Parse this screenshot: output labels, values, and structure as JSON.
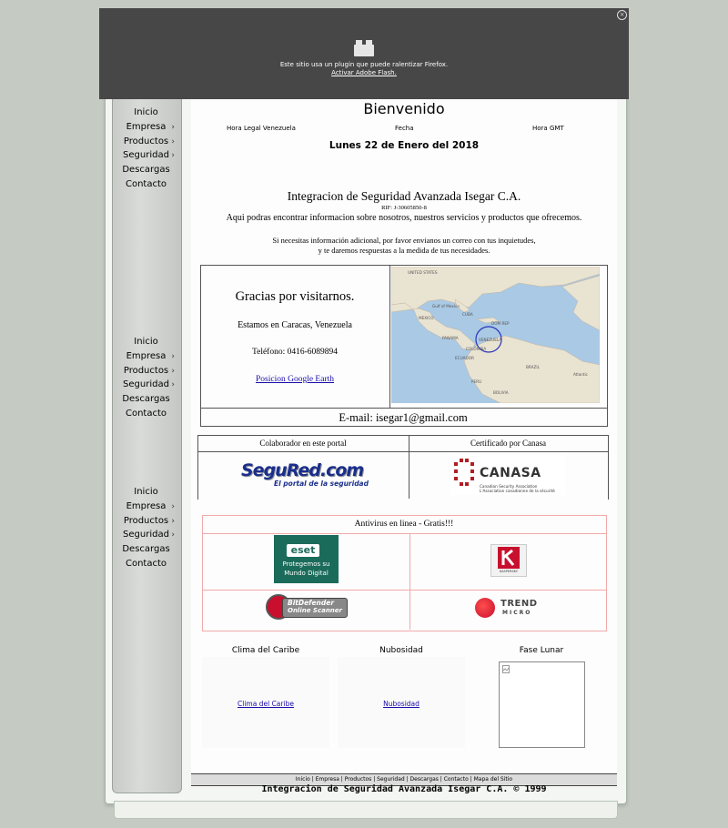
{
  "flash_bar": {
    "message": "Este sitio usa un plugin que puede ralentizar Firefox.",
    "link": "Activar Adobe Flash."
  },
  "menus": [
    {
      "items": [
        {
          "label": "Inicio",
          "arrow": ""
        },
        {
          "label": "Empresa",
          "arrow": "›"
        },
        {
          "label": "Productos",
          "arrow": "›"
        },
        {
          "label": "Seguridad",
          "arrow": "›"
        },
        {
          "label": "Descargas",
          "arrow": ""
        },
        {
          "label": "Contacto",
          "arrow": ""
        }
      ]
    },
    {
      "items": [
        {
          "label": "Inicio",
          "arrow": ""
        },
        {
          "label": "Empresa",
          "arrow": "›"
        },
        {
          "label": "Productos",
          "arrow": "›"
        },
        {
          "label": "Seguridad",
          "arrow": "›"
        },
        {
          "label": "Descargas",
          "arrow": ""
        },
        {
          "label": "Contacto",
          "arrow": ""
        }
      ]
    },
    {
      "items": [
        {
          "label": "Inicio",
          "arrow": ""
        },
        {
          "label": "Empresa",
          "arrow": "›"
        },
        {
          "label": "Productos",
          "arrow": "›"
        },
        {
          "label": "Seguridad",
          "arrow": "›"
        },
        {
          "label": "Descargas",
          "arrow": ""
        },
        {
          "label": "Contacto",
          "arrow": ""
        }
      ]
    }
  ],
  "header": {
    "title": "Bienvenido",
    "col_hora_legal": "Hora Legal Venezuela",
    "col_fecha": "Fecha",
    "col_hora_gmt": "Hora GMT",
    "date": "Lunes 22 de Enero del 2018"
  },
  "intro": {
    "company": "Integracion de Seguridad Avanzada Isegar C.A.",
    "rif": "RIF: J-30605850-8",
    "tagline": "Aqui podras encontrar informacion sobre nosotros, nuestros servicios y productos que ofrecemos.",
    "info1": "Si necesitas información adicional, por favor envianos un correo con tus inquietudes,",
    "info2": "y te daremos respuestas a la medida de tus necesidades."
  },
  "contact": {
    "thanks": "Gracias por visitarnos.",
    "location": "Estamos en Caracas, Venezuela",
    "phone": "Teléfono: 0416-6089894",
    "earth_link": "Posicion Google Earth",
    "email": "E-mail: isegar1@gmail.com",
    "map_labels": [
      "UNITED STATES",
      "Gulf of Mexico",
      "MEXICO",
      "CUBA",
      "DOM REP",
      "VENEZUELA",
      "COLOMBIA",
      "PANAMA",
      "BRAZIL",
      "ECUADOR",
      "PERU",
      "BOLIVIA",
      "Atlantic"
    ]
  },
  "partners": {
    "left_header": "Colaborador en este portal",
    "right_header": "Certificado por Canasa",
    "segured_text": "SeguRed.com",
    "segured_sub": "El portal de la seguridad",
    "canasa_text": "CANASA",
    "canasa_sub1": "Canadian Security Association",
    "canasa_sub2": "L'Association canadienne de la sécurité"
  },
  "antivirus": {
    "header": "Antivirus en linea - Gratis!!!",
    "eset_brand": "eset",
    "eset_line1": "Protegemos su",
    "eset_line2": "Mundo Digital",
    "kaspersky": "KASPERSKY",
    "bitdefender1": "BitDefender",
    "bitdefender2": "Online Scanner",
    "trend1": "TREND",
    "trend2": "MICRO"
  },
  "widgets": {
    "clima_title": "Clima del Caribe",
    "clima_link": "Clima del Caribe",
    "nubosidad_title": "Nubosidad",
    "nubosidad_link": "Nubosidad",
    "fase_title": "Fase Lunar"
  },
  "footer": {
    "links": "Inicio | Empresa | Productos | Seguridad | Descargas | Contacto | Mapa del Sitio",
    "copyright": "Integracion de Seguridad Avanzada Isegar C.A. © 1999"
  },
  "colors": {
    "flash_bg": "#474747",
    "antivirus_border": "#f2a9a9",
    "canasa_red": "#b01e23",
    "eset_green": "#1b6b5b"
  }
}
